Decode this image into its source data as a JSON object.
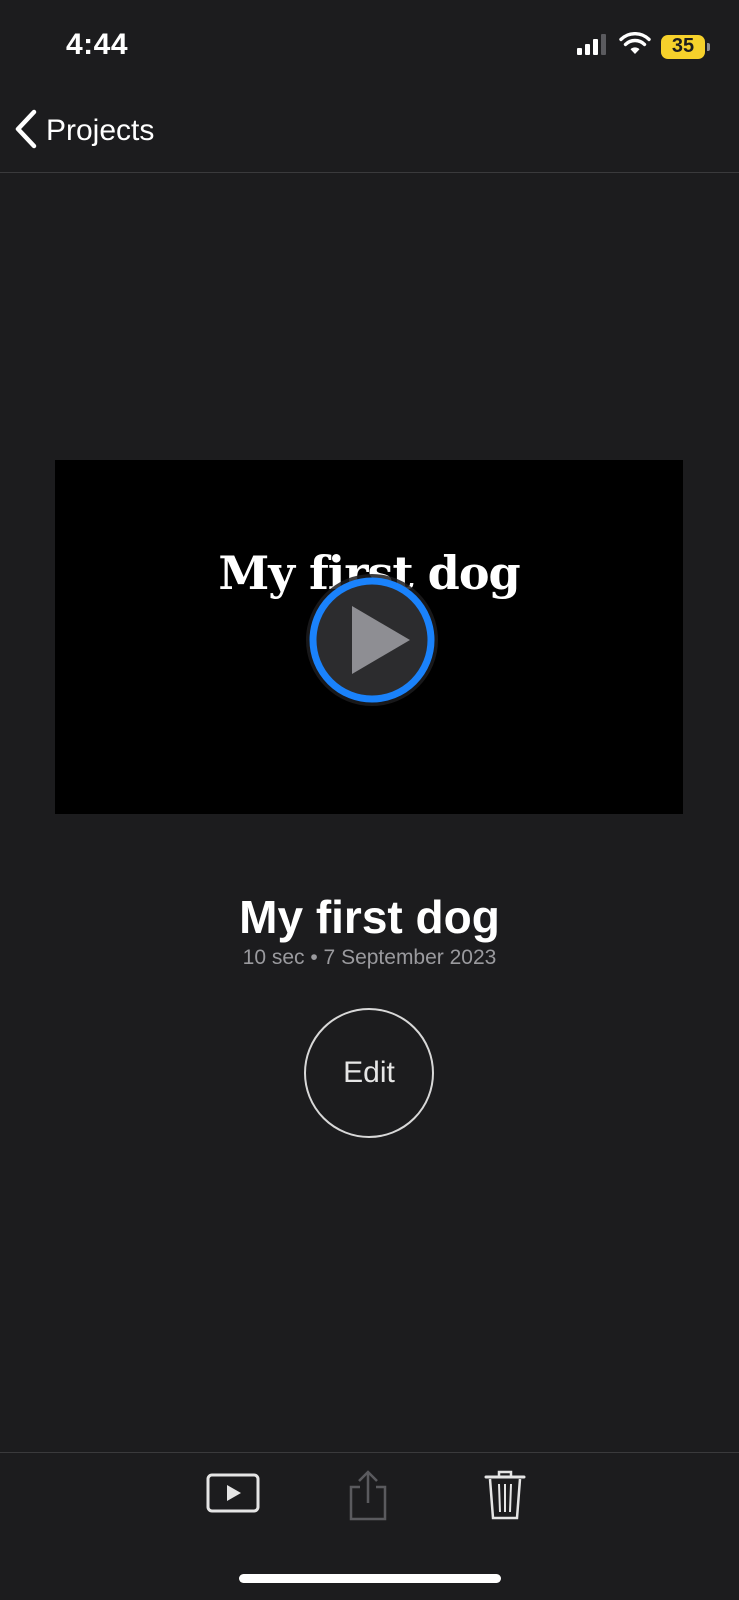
{
  "status_bar": {
    "time": "4:44",
    "battery_level": "35",
    "signal_bars": 3,
    "battery_color": "#f6d12b",
    "icons": [
      "cellular-signal-icon",
      "wifi-icon",
      "battery-icon"
    ]
  },
  "nav": {
    "back_label": "Projects",
    "back_icon": "chevron-left-icon"
  },
  "preview": {
    "title_card_text": "My first dog",
    "play_icon": "play-circle-icon",
    "play_ring_color": "#1a82fb"
  },
  "project": {
    "title": "My first dog",
    "meta": "10 sec • 7 September 2023"
  },
  "actions": {
    "edit_label": "Edit"
  },
  "toolbar": {
    "icons": [
      "play-video-icon",
      "share-icon",
      "trash-icon"
    ]
  }
}
